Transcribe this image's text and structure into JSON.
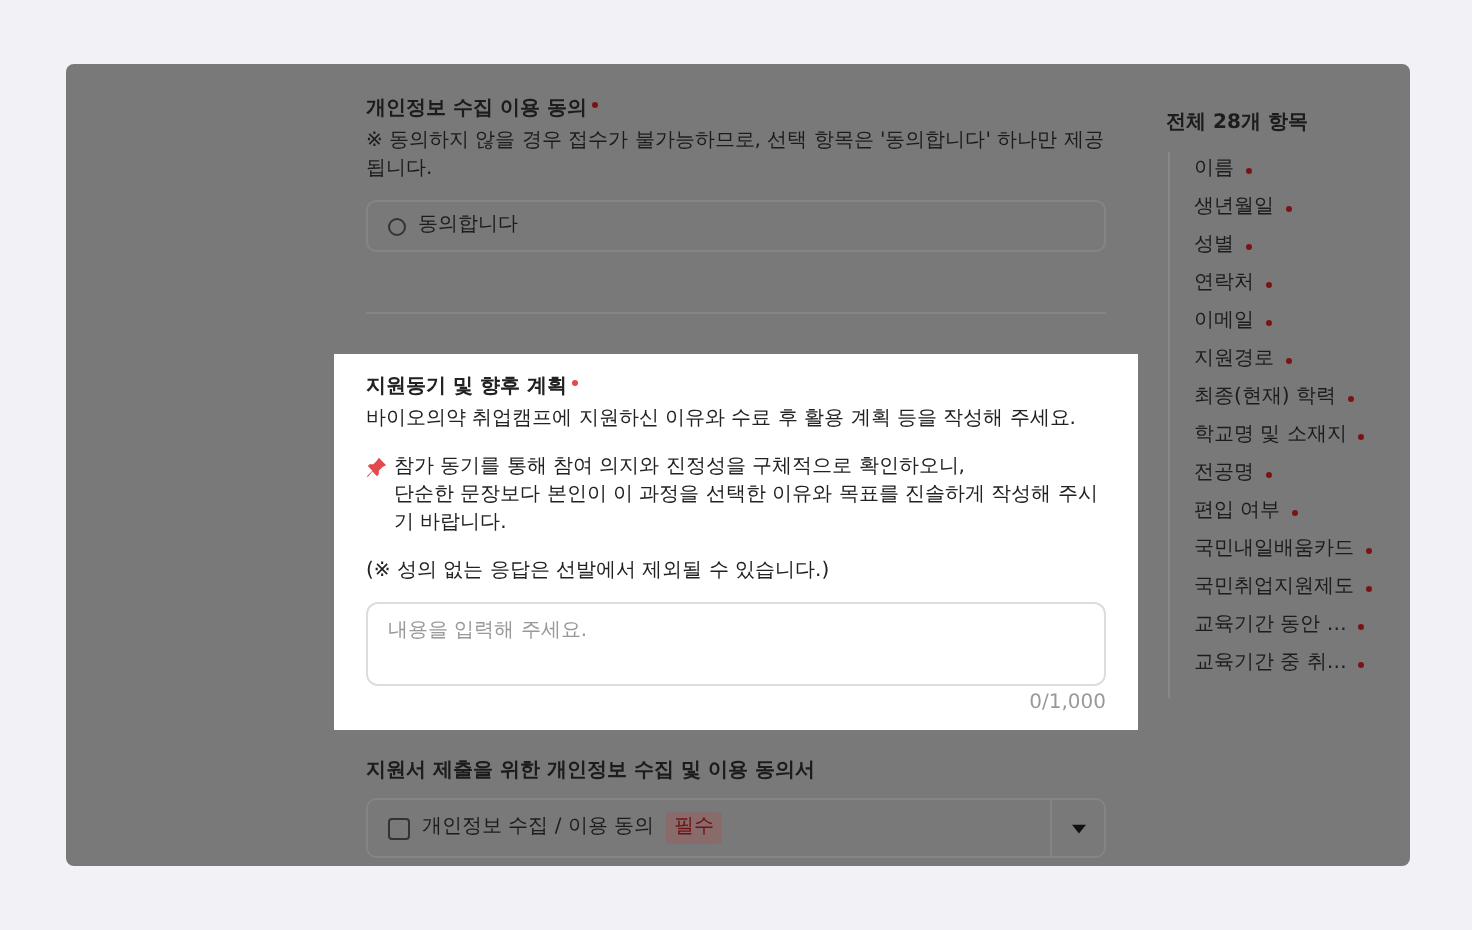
{
  "sections": [
    {
      "kind": "radio",
      "title": "개인정보 수집 이용 동의",
      "required": true,
      "highlighted": false,
      "note": "※ 동의하지 않을 경우 접수가 불가능하므로, 선택 항목은 '동의합니다' 하나만 제공됩니다.",
      "options": [
        {
          "label": "동의합니다",
          "selected": false
        }
      ]
    },
    {
      "kind": "textarea",
      "title": "지원동기 및 향후 계획",
      "required": true,
      "highlighted": true,
      "description": "바이오의약 취업캠프에 지원하신 이유와 수료 후 활용 계획 등을 작성해 주세요.",
      "pinned_note": "참가 동기를 통해 참여 의지와 진정성을 구체적으로 확인하오니,\n단순한 문장보다 본인이 이 과정을 선택한 이유와 목표를 진솔하게 작성해 주시기 바랍니다.",
      "warning": "(※ 성의 없는 응답은 선발에서 제외될 수 있습니다.)",
      "placeholder": "내용을 입력해 주세요.",
      "counter": "0/1,000"
    },
    {
      "kind": "accordion",
      "title": "지원서 제출을 위한 개인정보 수집 및 이용 동의서",
      "highlighted": false,
      "item": {
        "label": "개인정보 수집 / 이용 동의",
        "checked": false,
        "tag": "필수",
        "expanded": false
      }
    }
  ],
  "outline": {
    "title": "전체 28개 항목",
    "items": [
      {
        "label": "이름",
        "required": true
      },
      {
        "label": "생년월일",
        "required": true
      },
      {
        "label": "성별",
        "required": true
      },
      {
        "label": "연락처",
        "required": true
      },
      {
        "label": "이메일",
        "required": true
      },
      {
        "label": "지원경로",
        "required": true
      },
      {
        "label": "최종(현재) 학력",
        "required": true
      },
      {
        "label": "학교명 및 소재지",
        "required": true
      },
      {
        "label": "전공명",
        "required": true
      },
      {
        "label": "편입 여부",
        "required": true
      },
      {
        "label": "국민내일배움카드",
        "required": true
      },
      {
        "label": "국민취업지원제도",
        "required": true
      },
      {
        "label": "교육기간 동안 …",
        "required": true
      },
      {
        "label": "교육기간 중 취…",
        "required": true
      }
    ]
  }
}
